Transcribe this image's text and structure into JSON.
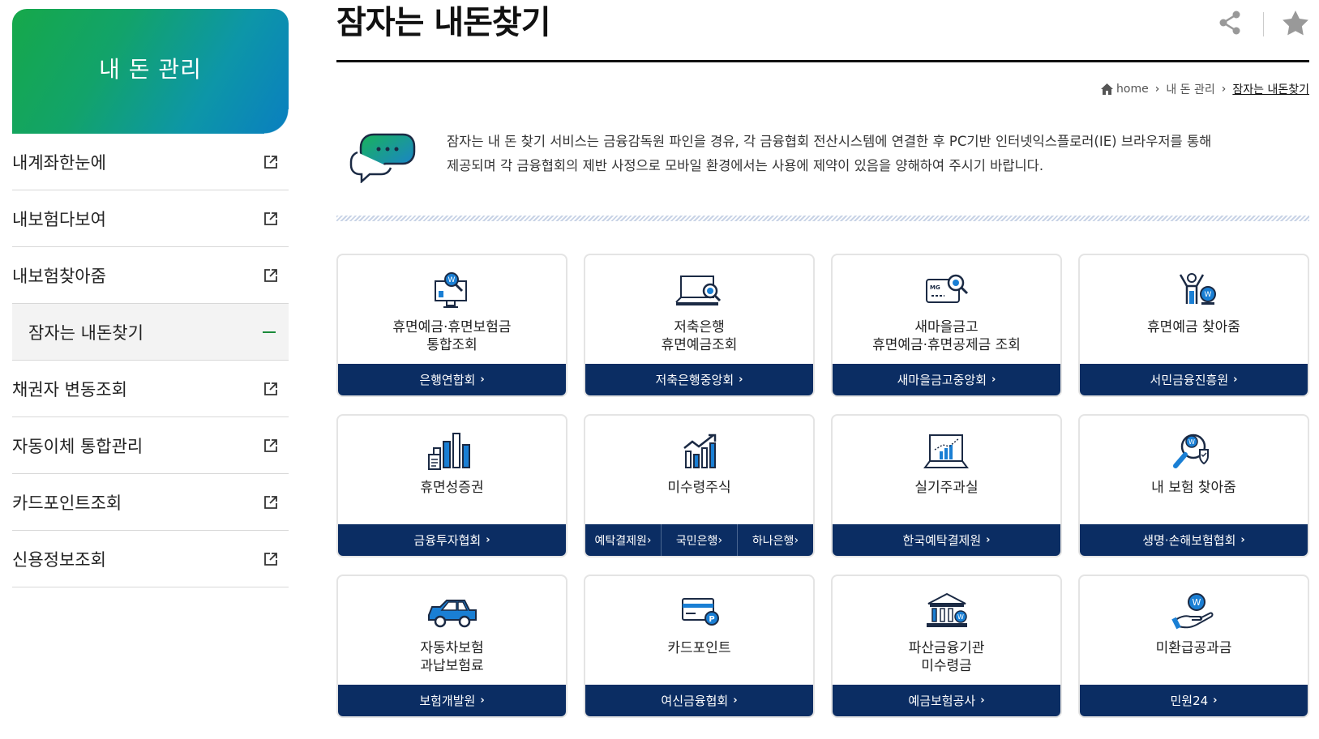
{
  "sidebar": {
    "title": "내 돈 관리",
    "items": [
      {
        "label": "내계좌한눈에",
        "active": false
      },
      {
        "label": "내보험다보여",
        "active": false
      },
      {
        "label": "내보험찾아줌",
        "active": false
      },
      {
        "label": "잠자는 내돈찾기",
        "active": true
      },
      {
        "label": "채권자 변동조회",
        "active": false
      },
      {
        "label": "자동이체 통합관리",
        "active": false
      },
      {
        "label": "카드포인트조회",
        "active": false
      },
      {
        "label": "신용정보조회",
        "active": false
      }
    ]
  },
  "page": {
    "title": "잠자는 내돈찾기",
    "breadcrumb": {
      "home": "home",
      "level1": "내 돈 관리",
      "current": "잠자는 내돈찾기"
    },
    "notice_line1": "잠자는 내 돈 찾기 서비스는 금융감독원 파인을 경유, 각 금융협회 전산시스템에 연결한 후 PC기반 인터넷익스플로러(IE) 브라우저를 통해",
    "notice_line2": "제공되며 각 금융협회의 제반 사정으로 모바일 환경에서는 사용에 제약이 있음을 양해하여 주시기 바랍니다."
  },
  "cards": [
    {
      "line1": "휴면예금·휴면보험금",
      "line2": "통합조회",
      "link": "은행연합회",
      "icon": "monitor-search-icon"
    },
    {
      "line1": "저축은행",
      "line2": "휴면예금조회",
      "link": "저축은행중앙회",
      "icon": "laptop-search-icon"
    },
    {
      "line1": "새마을금고",
      "line2": "휴면예금·휴면공제금 조회",
      "link": "새마을금고중앙회",
      "icon": "card-search-icon"
    },
    {
      "line1": "휴면예금 찾아줌",
      "line2": "",
      "link": "서민금융진흥원",
      "icon": "person-coin-icon"
    },
    {
      "line1": "휴면성증권",
      "line2": "",
      "link": "금융투자협회",
      "icon": "bar-document-icon"
    },
    {
      "line1": "미수령주식",
      "line2": "",
      "links": [
        "예탁결제원",
        "국민은행",
        "하나은행"
      ],
      "icon": "growth-chart-icon"
    },
    {
      "line1": "실기주과실",
      "line2": "",
      "link": "한국예탁결제원",
      "icon": "board-chart-icon"
    },
    {
      "line1": "내 보험 찾아줌",
      "line2": "",
      "link": "생명·손해보험협회",
      "icon": "magnifier-shield-icon"
    },
    {
      "line1": "자동차보험",
      "line2": "과납보험료",
      "link": "보험개발원",
      "icon": "car-icon"
    },
    {
      "line1": "카드포인트",
      "line2": "",
      "link": "여신금융협회",
      "icon": "card-point-icon"
    },
    {
      "line1": "파산금융기관",
      "line2": "미수령금",
      "link": "예금보험공사",
      "icon": "bank-icon"
    },
    {
      "line1": "미환급공과금",
      "line2": "",
      "link": "민원24",
      "icon": "hand-coin-icon"
    }
  ],
  "colors": {
    "navy": "#0b2d63",
    "accent_blue": "#1a7fd4",
    "green": "#16a84a"
  }
}
